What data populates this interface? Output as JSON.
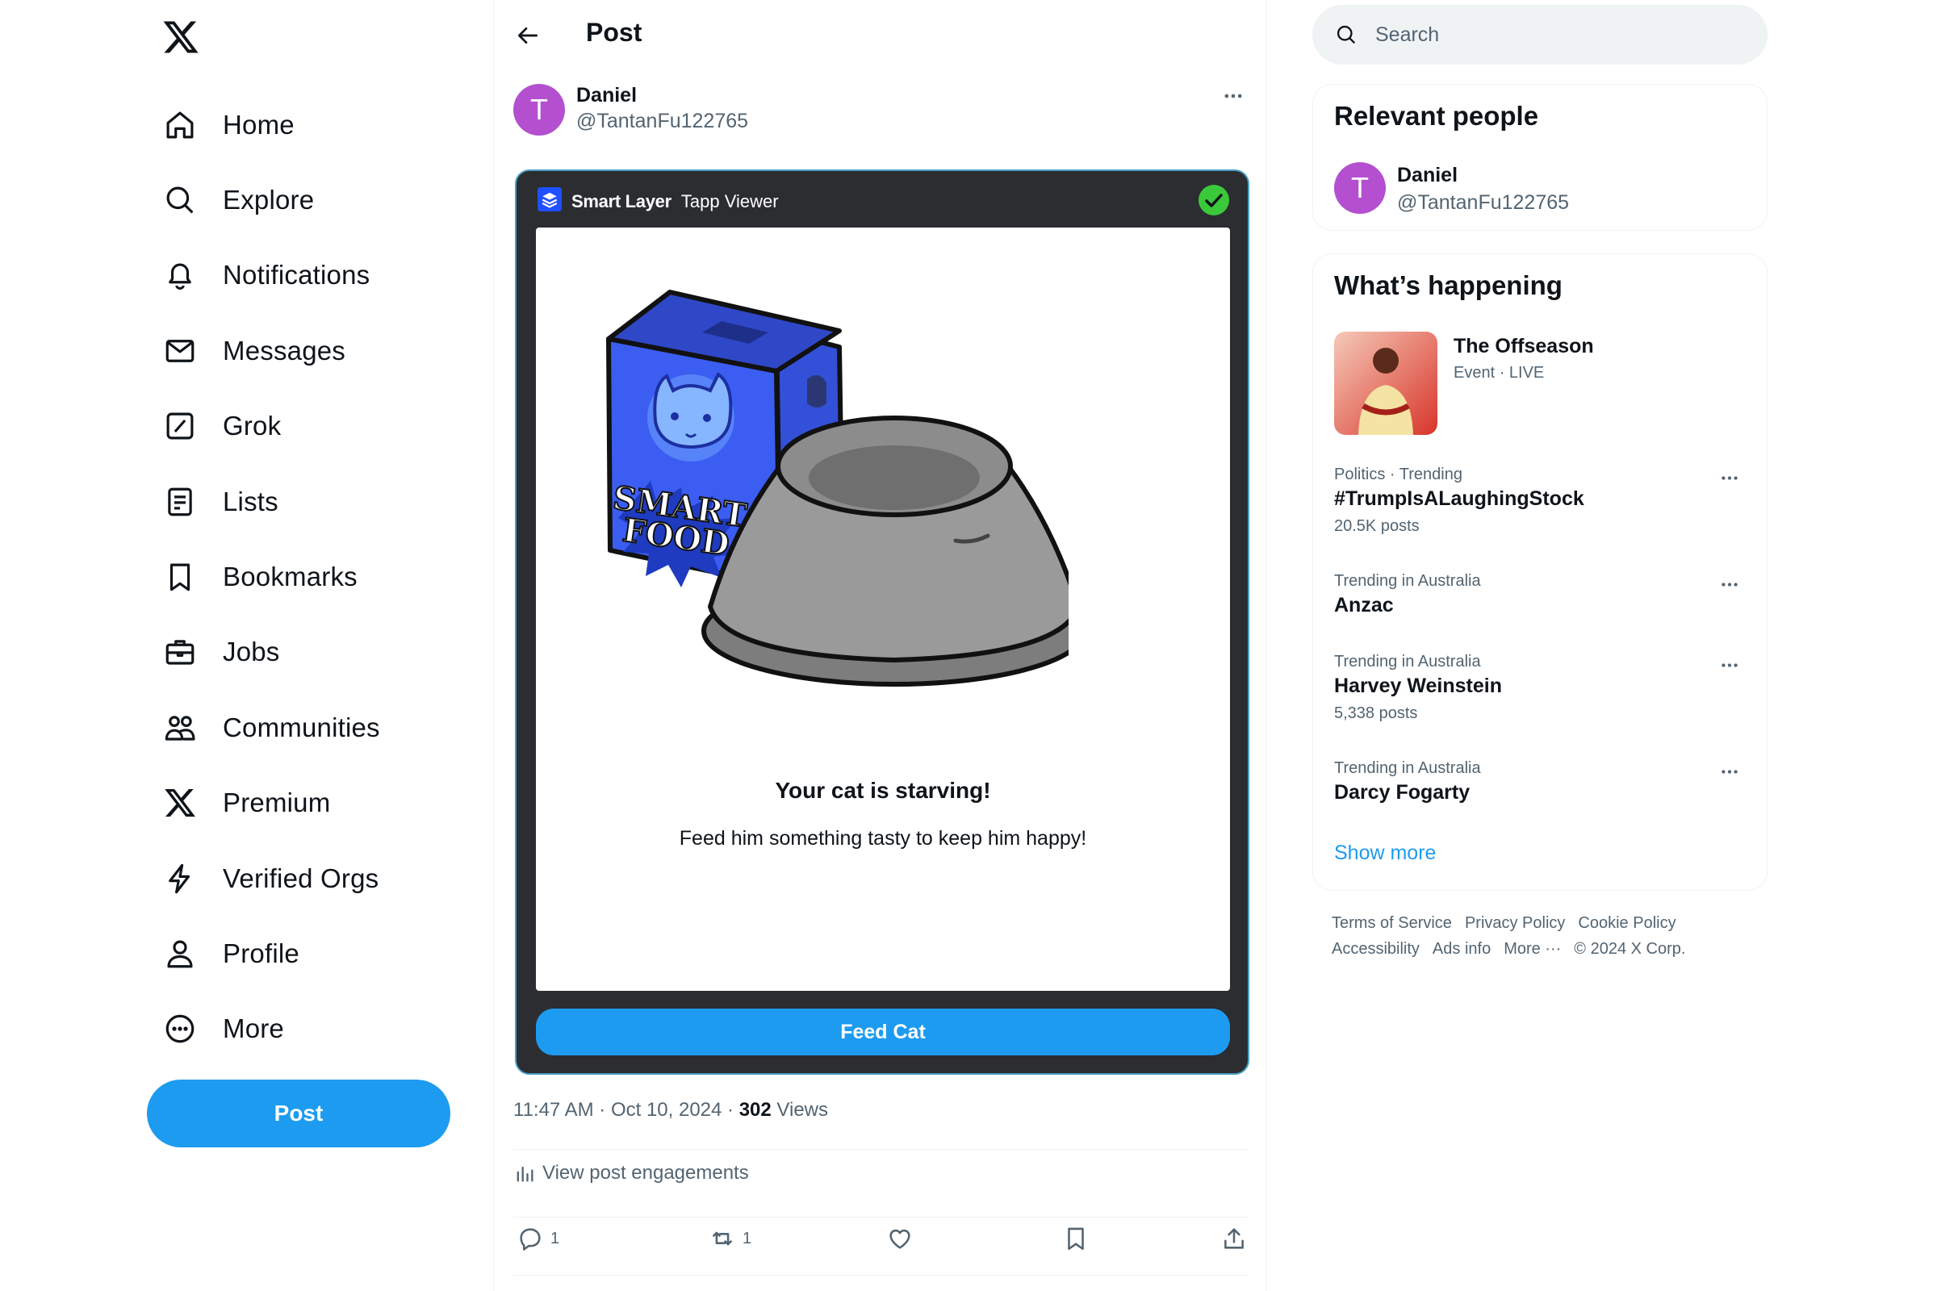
{
  "nav": {
    "items": [
      {
        "label": "Home",
        "icon": "home-icon"
      },
      {
        "label": "Explore",
        "icon": "search-icon"
      },
      {
        "label": "Notifications",
        "icon": "bell-icon"
      },
      {
        "label": "Messages",
        "icon": "envelope-icon"
      },
      {
        "label": "Grok",
        "icon": "grok-icon"
      },
      {
        "label": "Lists",
        "icon": "list-icon"
      },
      {
        "label": "Bookmarks",
        "icon": "bookmark-icon"
      },
      {
        "label": "Jobs",
        "icon": "briefcase-icon"
      },
      {
        "label": "Communities",
        "icon": "people-icon"
      },
      {
        "label": "Premium",
        "icon": "x-logo-icon"
      },
      {
        "label": "Verified Orgs",
        "icon": "lightning-icon"
      },
      {
        "label": "Profile",
        "icon": "person-icon"
      },
      {
        "label": "More",
        "icon": "more-circle-icon"
      }
    ],
    "post_button": "Post"
  },
  "header": {
    "title": "Post"
  },
  "post": {
    "author_initial": "T",
    "author_name": "Daniel",
    "author_handle": "@TantanFu122765",
    "timestamp": "11:47 AM · Oct 10, 2024 · ",
    "views_count": "302",
    "views_label": " Views",
    "engagements_label": "View post engagements",
    "actions": {
      "replies": "1",
      "reposts": "1"
    }
  },
  "tapp": {
    "brand": "Smart Layer",
    "viewer": "Tapp Viewer",
    "art_text_1": "SMART",
    "art_text_2": "FOOD",
    "message_title": "Your cat is starving!",
    "message_body": "Feed him something tasty to keep him happy!",
    "button": "Feed Cat"
  },
  "search": {
    "placeholder": "Search"
  },
  "relevant": {
    "title": "Relevant people",
    "person": {
      "initial": "T",
      "name": "Daniel",
      "handle": "@TantanFu122765"
    }
  },
  "happening": {
    "title": "What’s happening",
    "event": {
      "title": "The Offseason",
      "subtitle": "Event · LIVE"
    },
    "trends": [
      {
        "context": "Politics · Trending",
        "name": "#TrumpIsALaughingStock",
        "count": "20.5K posts"
      },
      {
        "context": "Trending in Australia",
        "name": "Anzac",
        "count": ""
      },
      {
        "context": "Trending in Australia",
        "name": "Harvey Weinstein",
        "count": "5,338 posts"
      },
      {
        "context": "Trending in Australia",
        "name": "Darcy Fogarty",
        "count": ""
      }
    ],
    "show_more": "Show more"
  },
  "footer": {
    "links": [
      "Terms of Service",
      "Privacy Policy",
      "Cookie Policy",
      "Accessibility",
      "Ads info",
      "More ···",
      "© 2024 X Corp."
    ]
  },
  "colors": {
    "accent": "#1d9bf0",
    "avatar": "#b44fd0",
    "tapp_bg": "#2b2d30",
    "verified_green": "#3ac93a"
  }
}
